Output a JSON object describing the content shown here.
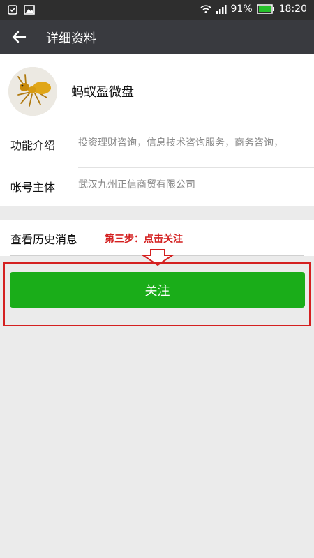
{
  "status_bar": {
    "battery": "91%",
    "time": "18:20"
  },
  "nav": {
    "title": "详细资料"
  },
  "profile": {
    "name": "蚂蚁盈微盘"
  },
  "info": {
    "intro_label": "功能介绍",
    "intro_value": "投资理财咨询，信息技术咨询服务，商务咨询，",
    "account_label": "帐号主体",
    "account_value": "武汉九州正信商贸有限公司"
  },
  "history": {
    "label": "查看历史消息",
    "annotation": "第三步：点击关注"
  },
  "follow_button": {
    "label": "关注"
  },
  "colors": {
    "nav_bg": "#393a3f",
    "button_green": "#1aad19",
    "annotation_red": "#d42020"
  }
}
